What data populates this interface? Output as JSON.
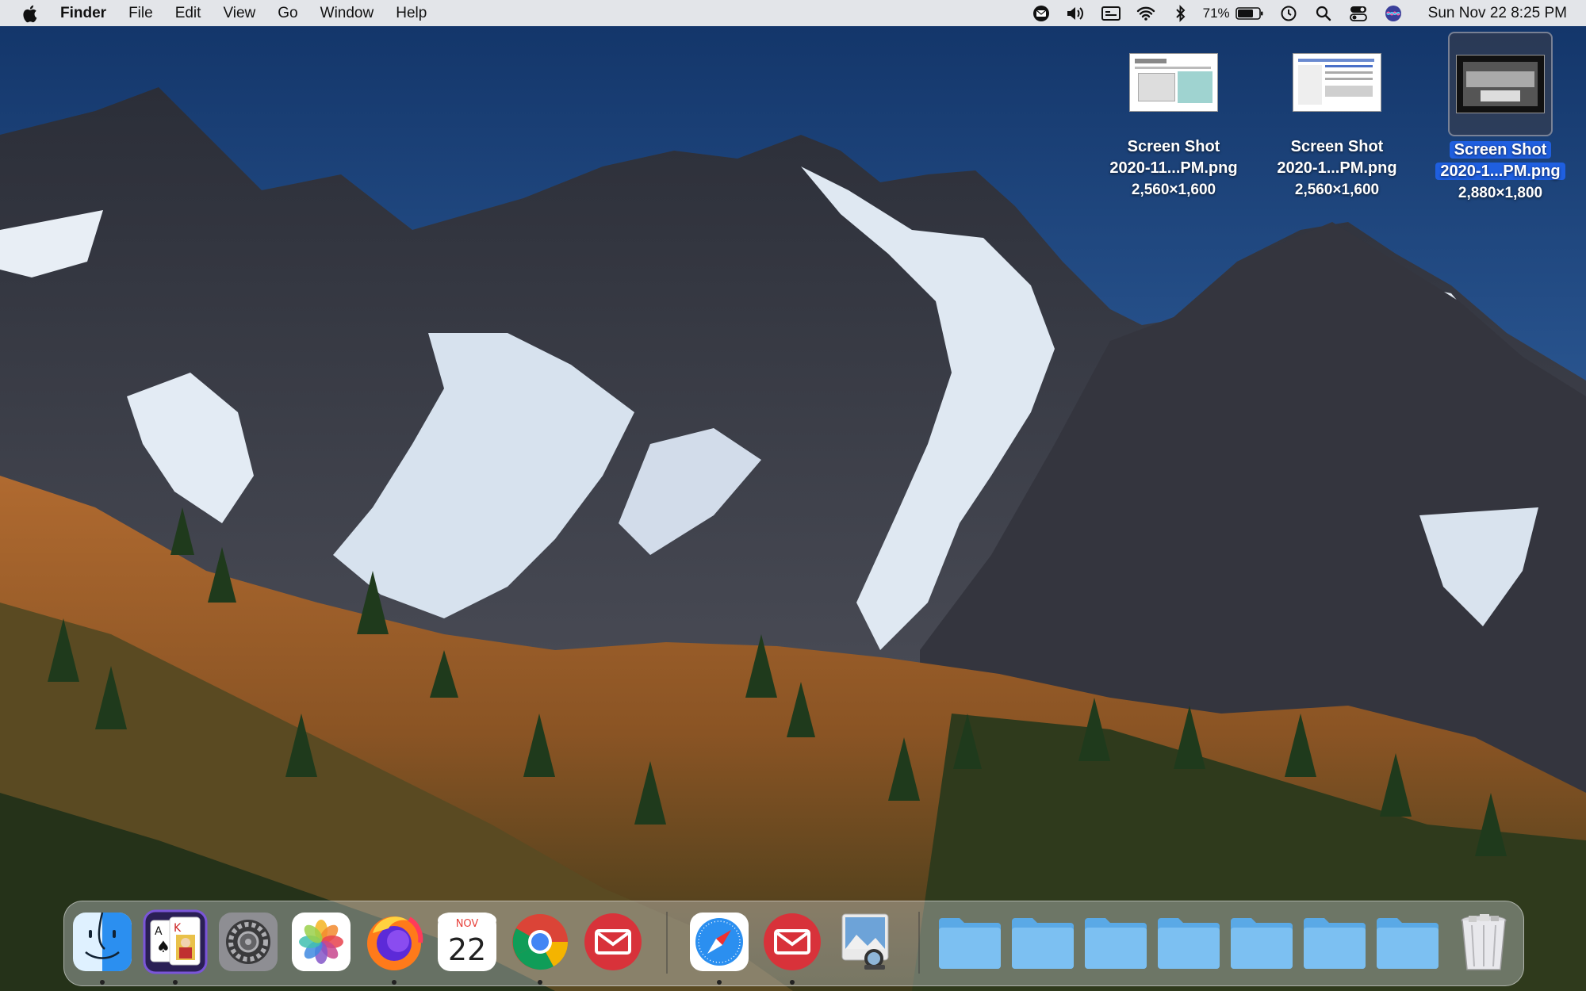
{
  "menubar": {
    "app_name": "Finder",
    "menus": [
      "File",
      "Edit",
      "View",
      "Go",
      "Window",
      "Help"
    ],
    "battery_percent": "71%",
    "datetime": "Sun Nov 22  8:25 PM",
    "status_icons": [
      "mail-status-icon",
      "volume-icon",
      "display-icon",
      "wifi-icon",
      "bluetooth-icon",
      "battery-icon",
      "time-machine-icon",
      "spotlight-icon",
      "control-center-icon",
      "siri-icon"
    ]
  },
  "desktop": {
    "files": [
      {
        "line1": "Screen Shot",
        "line2": "2020-11...PM.png",
        "dims": "2,560×1,600",
        "selected": false
      },
      {
        "line1": "Screen Shot",
        "line2": "2020-1...PM.png",
        "dims": "2,560×1,600",
        "selected": false
      },
      {
        "line1": "Screen Shot",
        "line2": "2020-1...PM.png",
        "dims": "2,880×1,800",
        "selected": true
      }
    ]
  },
  "dock": {
    "apps": [
      "Finder",
      "Solitaire",
      "System Preferences",
      "Photos",
      "Firefox",
      "Calendar",
      "Chrome",
      "Airmail",
      "Safari",
      "Mail",
      "Preview"
    ],
    "calendar_month": "NOV",
    "calendar_day": "22",
    "folders_count_label": "",
    "trash": "Trash"
  },
  "colors": {
    "menubar_bg": "#ececee",
    "selection_blue": "#1f5fe0",
    "sky_top": "#153a72",
    "sky_bottom": "#4f7fb8"
  }
}
